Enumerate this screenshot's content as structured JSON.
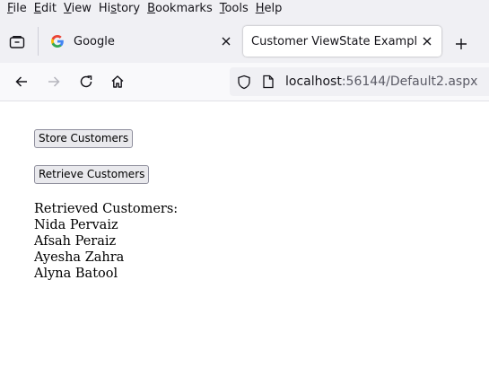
{
  "menubar": {
    "items": [
      {
        "key": "F",
        "rest": "ile"
      },
      {
        "key": "E",
        "rest": "dit"
      },
      {
        "key": "V",
        "rest": "iew"
      },
      {
        "pre": "Hi",
        "key": "s",
        "rest": "tory"
      },
      {
        "key": "B",
        "rest": "ookmarks"
      },
      {
        "key": "T",
        "rest": "ools"
      },
      {
        "key": "H",
        "rest": "elp"
      }
    ]
  },
  "tabs": [
    {
      "title": "Google",
      "icon": "google-favicon-icon"
    },
    {
      "title": "Customer ViewState Example",
      "active": true
    }
  ],
  "urlbar": {
    "host": "localhost",
    "rest": ":56144/Default2.aspx"
  },
  "page": {
    "store_button": "Store Customers",
    "retrieve_button": "Retrieve Customers",
    "result_heading": "Retrieved Customers:",
    "customers": [
      "Nida Pervaiz",
      "Afsah Peraiz",
      "Ayesha Zahra",
      "Alyna Batool"
    ]
  },
  "colors": {
    "chrome": "#f0f0f4",
    "toolbar": "#f9f9fb",
    "button_bg": "#e9e9ed"
  }
}
